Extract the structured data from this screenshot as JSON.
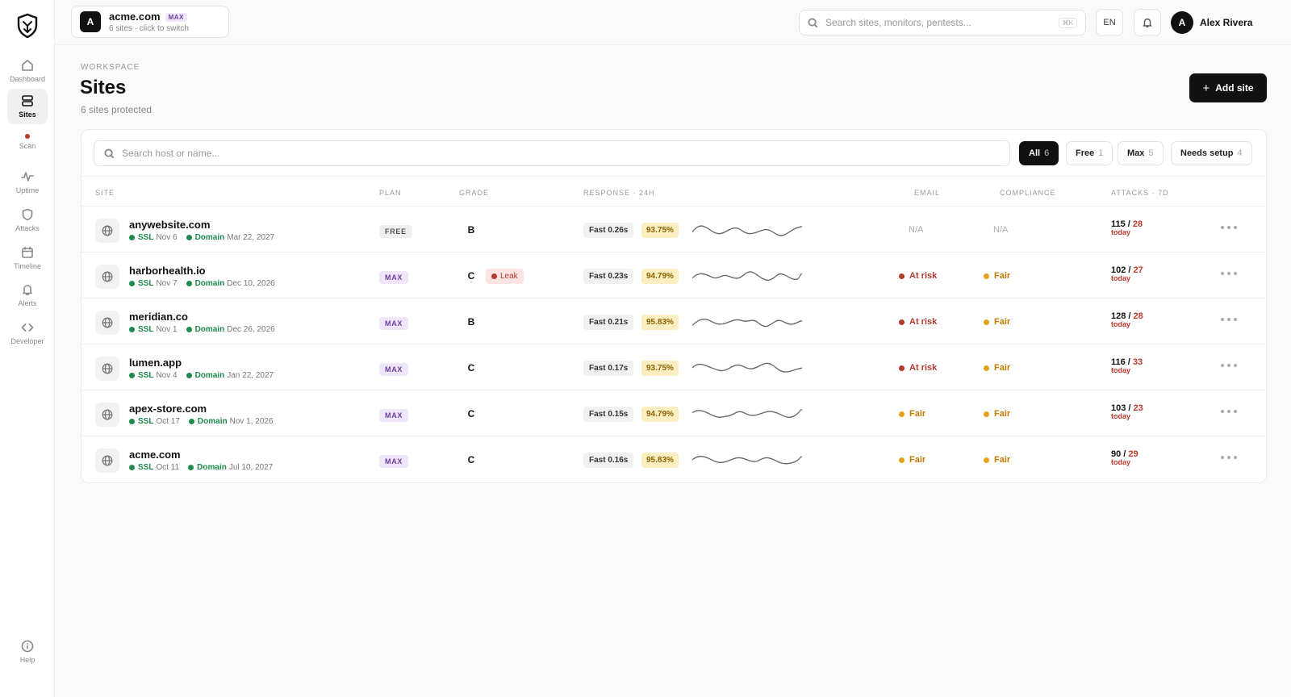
{
  "nav": {
    "items": [
      {
        "label": "Dashboard",
        "icon": "home-icon"
      },
      {
        "label": "Sites",
        "icon": "server-icon",
        "active": true
      },
      {
        "label": "Scan",
        "icon": "scan-dot-icon"
      },
      {
        "label": "Uptime",
        "icon": "activity-icon"
      },
      {
        "label": "Attacks",
        "icon": "shield-icon"
      },
      {
        "label": "Timeline",
        "icon": "calendar-icon"
      },
      {
        "label": "Alerts",
        "icon": "bell-icon"
      },
      {
        "label": "Developer",
        "icon": "code-icon"
      }
    ],
    "help_label": "Help"
  },
  "workspace": {
    "initial": "A",
    "name": "acme.com",
    "badge": "MAX",
    "subtitle": "6 sites · click to switch"
  },
  "topbar": {
    "search_placeholder": "Search sites, monitors, pentests...",
    "shortcut": "⌘K",
    "lang": "EN",
    "user_initial": "A",
    "user_name": "Alex Rivera"
  },
  "page": {
    "eyebrow": "WORKSPACE",
    "title": "Sites",
    "subtitle": "6 sites protected",
    "add_button": "Add site"
  },
  "filters": {
    "search_placeholder": "Search host or name...",
    "chips": [
      {
        "label": "All",
        "count": "6",
        "active": true
      },
      {
        "label": "Free",
        "count": "1"
      },
      {
        "label": "Max",
        "count": "5"
      },
      {
        "label": "Needs setup",
        "count": "4"
      }
    ]
  },
  "table": {
    "headers": {
      "site": "SITE",
      "plan": "PLAN",
      "grade": "GRADE",
      "response": "RESPONSE · 24H",
      "email": "EMAIL",
      "compliance": "COMPLIANCE",
      "attacks": "ATTACKS · 7D"
    },
    "rows": [
      {
        "host": "anywebsite.com",
        "ssl_label": "SSL",
        "ssl": "Nov 6",
        "domain_label": "Domain",
        "domain": "Mar 22, 2027",
        "plan": "FREE",
        "grade": "B",
        "leak": "",
        "response": "Fast 0.26s",
        "uptime": "93.75%",
        "email": "N/A",
        "compliance": "N/A",
        "attacks_total": "115",
        "attacks_today": "28",
        "today_label": "today"
      },
      {
        "host": "harborhealth.io",
        "ssl_label": "SSL",
        "ssl": "Nov 7",
        "domain_label": "Domain",
        "domain": "Dec 10, 2026",
        "plan": "MAX",
        "grade": "C",
        "leak": "Leak",
        "response": "Fast 0.23s",
        "uptime": "94.79%",
        "email": "At risk",
        "compliance": "Fair",
        "attacks_total": "102",
        "attacks_today": "27",
        "today_label": "today"
      },
      {
        "host": "meridian.co",
        "ssl_label": "SSL",
        "ssl": "Nov 1",
        "domain_label": "Domain",
        "domain": "Dec 26, 2026",
        "plan": "MAX",
        "grade": "B",
        "leak": "",
        "response": "Fast 0.21s",
        "uptime": "95.83%",
        "email": "At risk",
        "compliance": "Fair",
        "attacks_total": "128",
        "attacks_today": "28",
        "today_label": "today"
      },
      {
        "host": "lumen.app",
        "ssl_label": "SSL",
        "ssl": "Nov 4",
        "domain_label": "Domain",
        "domain": "Jan 22, 2027",
        "plan": "MAX",
        "grade": "C",
        "leak": "",
        "response": "Fast 0.17s",
        "uptime": "93.75%",
        "email": "At risk",
        "compliance": "Fair",
        "attacks_total": "116",
        "attacks_today": "33",
        "today_label": "today"
      },
      {
        "host": "apex-store.com",
        "ssl_label": "SSL",
        "ssl": "Oct 17",
        "domain_label": "Domain",
        "domain": "Nov 1, 2026",
        "plan": "MAX",
        "grade": "C",
        "leak": "",
        "response": "Fast 0.15s",
        "uptime": "94.79%",
        "email": "Fair",
        "compliance": "Fair",
        "attacks_total": "103",
        "attacks_today": "23",
        "today_label": "today"
      },
      {
        "host": "acme.com",
        "ssl_label": "SSL",
        "ssl": "Oct 11",
        "domain_label": "Domain",
        "domain": "Jul 10, 2027",
        "plan": "MAX",
        "grade": "C",
        "leak": "",
        "response": "Fast 0.16s",
        "uptime": "95.83%",
        "email": "Fair",
        "compliance": "Fair",
        "attacks_total": "90",
        "attacks_today": "29",
        "today_label": "today"
      }
    ]
  },
  "colors": {
    "accent": "#111111",
    "max_badge": "#6b3fa0",
    "ok_green": "#1e8a4c",
    "risk_red": "#b03a2e",
    "fair_amber": "#e3a21a"
  }
}
